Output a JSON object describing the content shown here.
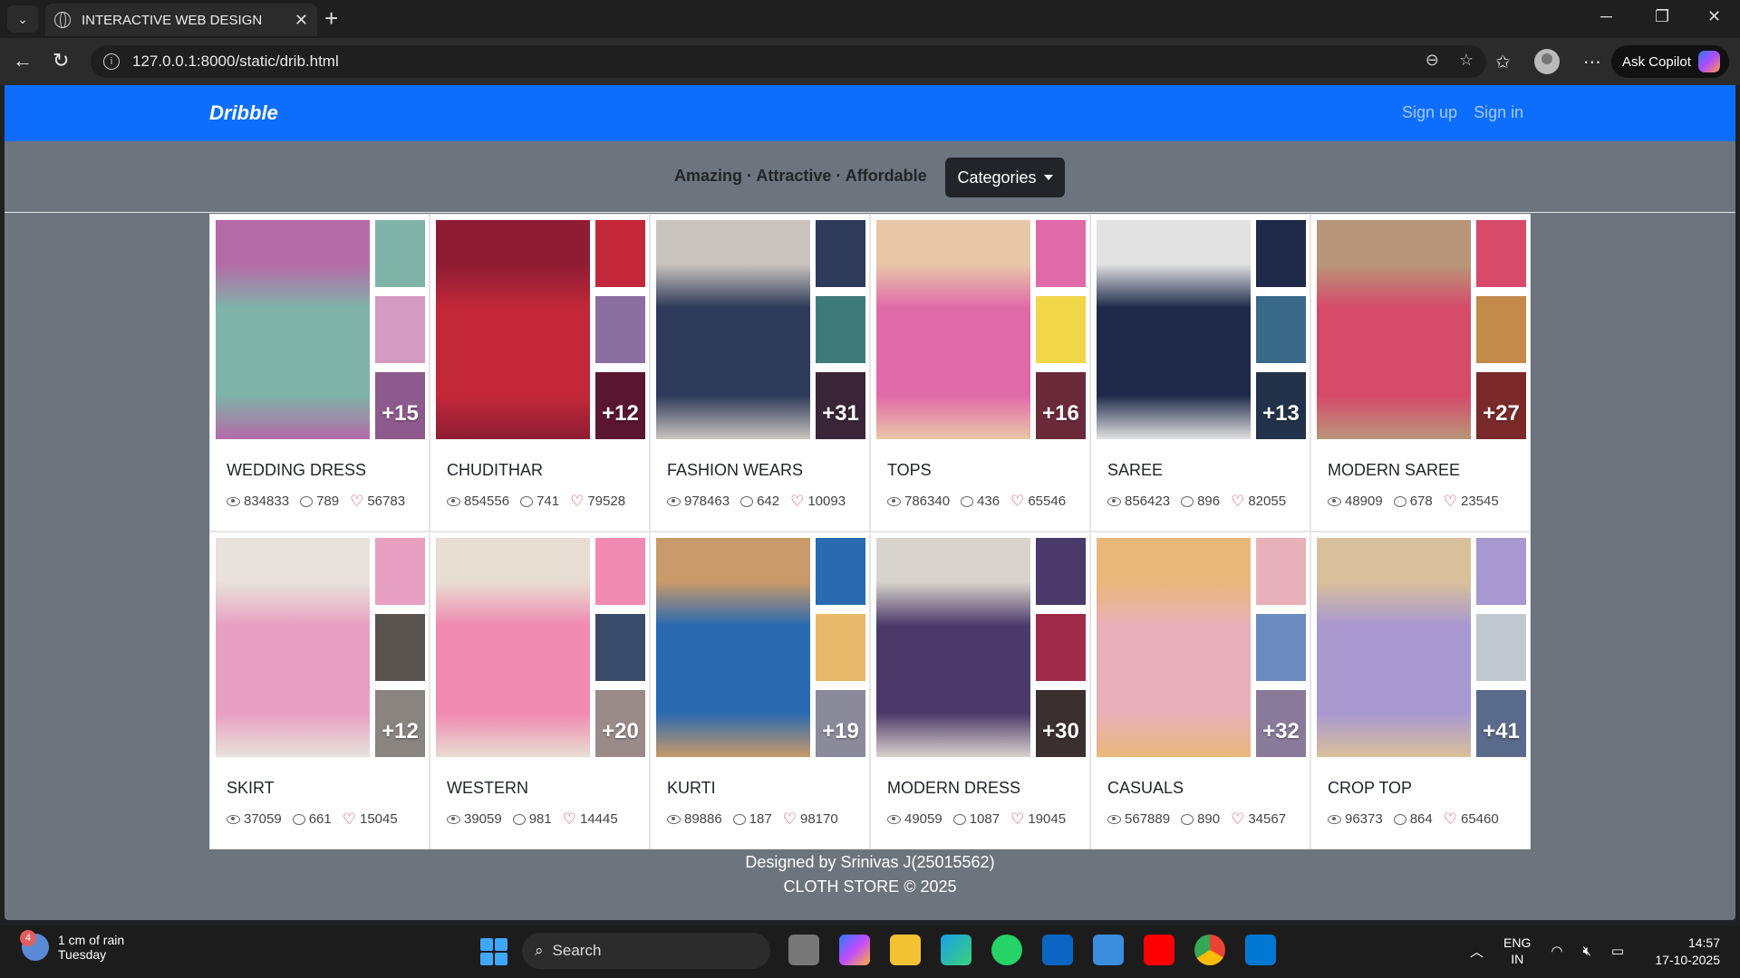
{
  "browser": {
    "tab_title": "INTERACTIVE WEB DESIGN",
    "url": "127.0.0.1:8000/static/drib.html",
    "copilot_label": "Ask Copilot"
  },
  "navbar": {
    "brand": "Dribble",
    "signup": "Sign up",
    "signin": "Sign in"
  },
  "hero": {
    "tagline": "Amazing · Attractive · Affordable",
    "categories_button": "Categories"
  },
  "cards": [
    {
      "title": "WEDDING DRESS",
      "views": "834833",
      "comments": "789",
      "likes": "56783",
      "more": "+15",
      "colors": [
        "#b56aa8",
        "#7fb3a8",
        "#d59ac0",
        "#8c5a8c"
      ]
    },
    {
      "title": "CHUDITHAR",
      "views": "854556",
      "comments": "741",
      "likes": "79528",
      "more": "+12",
      "colors": [
        "#8e1d33",
        "#c2283a",
        "#8a6fa0",
        "#5a1530"
      ]
    },
    {
      "title": "FASHION WEARS",
      "views": "978463",
      "comments": "642",
      "likes": "10093",
      "more": "+31",
      "colors": [
        "#c9c4bf",
        "#2d3a5a",
        "#3f7a7a",
        "#3a2538"
      ]
    },
    {
      "title": "TOPS",
      "views": "786340",
      "comments": "436",
      "likes": "65546",
      "more": "+16",
      "colors": [
        "#e8c7a8",
        "#e06aa8",
        "#f2d64a",
        "#6a2a3a"
      ]
    },
    {
      "title": "SAREE",
      "views": "856423",
      "comments": "896",
      "likes": "82055",
      "more": "+13",
      "colors": [
        "#e2e2e2",
        "#1f2a4a",
        "#3a6a8a",
        "#22324a"
      ]
    },
    {
      "title": "MODERN SAREE",
      "views": "48909",
      "comments": "678",
      "likes": "23545",
      "more": "+27",
      "colors": [
        "#b8967a",
        "#d64a6a",
        "#c48a4a",
        "#7a2a2a"
      ]
    },
    {
      "title": "SKIRT",
      "views": "37059",
      "comments": "661",
      "likes": "15045",
      "more": "+12",
      "colors": [
        "#e7e2dc",
        "#e8a0c0",
        "#5a5450",
        "#8a8480"
      ]
    },
    {
      "title": "WESTERN",
      "views": "39059",
      "comments": "981",
      "likes": "14445",
      "more": "+20",
      "colors": [
        "#e8ddd2",
        "#f08ab0",
        "#3a4a6a",
        "#9a8a8a"
      ]
    },
    {
      "title": "KURTI",
      "views": "89886",
      "comments": "187",
      "likes": "98170",
      "more": "+19",
      "colors": [
        "#c99a6a",
        "#2a6ab0",
        "#e8b86a",
        "#8a8a9a"
      ]
    },
    {
      "title": "MODERN DRESS",
      "views": "49059",
      "comments": "1087",
      "likes": "19045",
      "more": "+30",
      "colors": [
        "#d8d4cc",
        "#4a3a6a",
        "#a02a4a",
        "#3a3030"
      ]
    },
    {
      "title": "CASUALS",
      "views": "567889",
      "comments": "890",
      "likes": "34567",
      "more": "+32",
      "colors": [
        "#e8b87a",
        "#e8b0b8",
        "#6a8ac0",
        "#8a7a9a"
      ]
    },
    {
      "title": "CROP TOP",
      "views": "96373",
      "comments": "864",
      "likes": "65460",
      "more": "+41",
      "colors": [
        "#d8c09a",
        "#a898d0",
        "#c0c8d0",
        "#5a6a8a"
      ]
    }
  ],
  "footer": {
    "line1": "Designed by Srinivas J(25015562)",
    "line2": "CLOTH STORE © 2025"
  },
  "taskbar": {
    "weather_text": "1 cm of rain",
    "weather_day": "Tuesday",
    "weather_badge": "4",
    "search_label": "Search",
    "lang_line1": "ENG",
    "lang_line2": "IN",
    "time": "14:57",
    "date": "17-10-2025"
  }
}
